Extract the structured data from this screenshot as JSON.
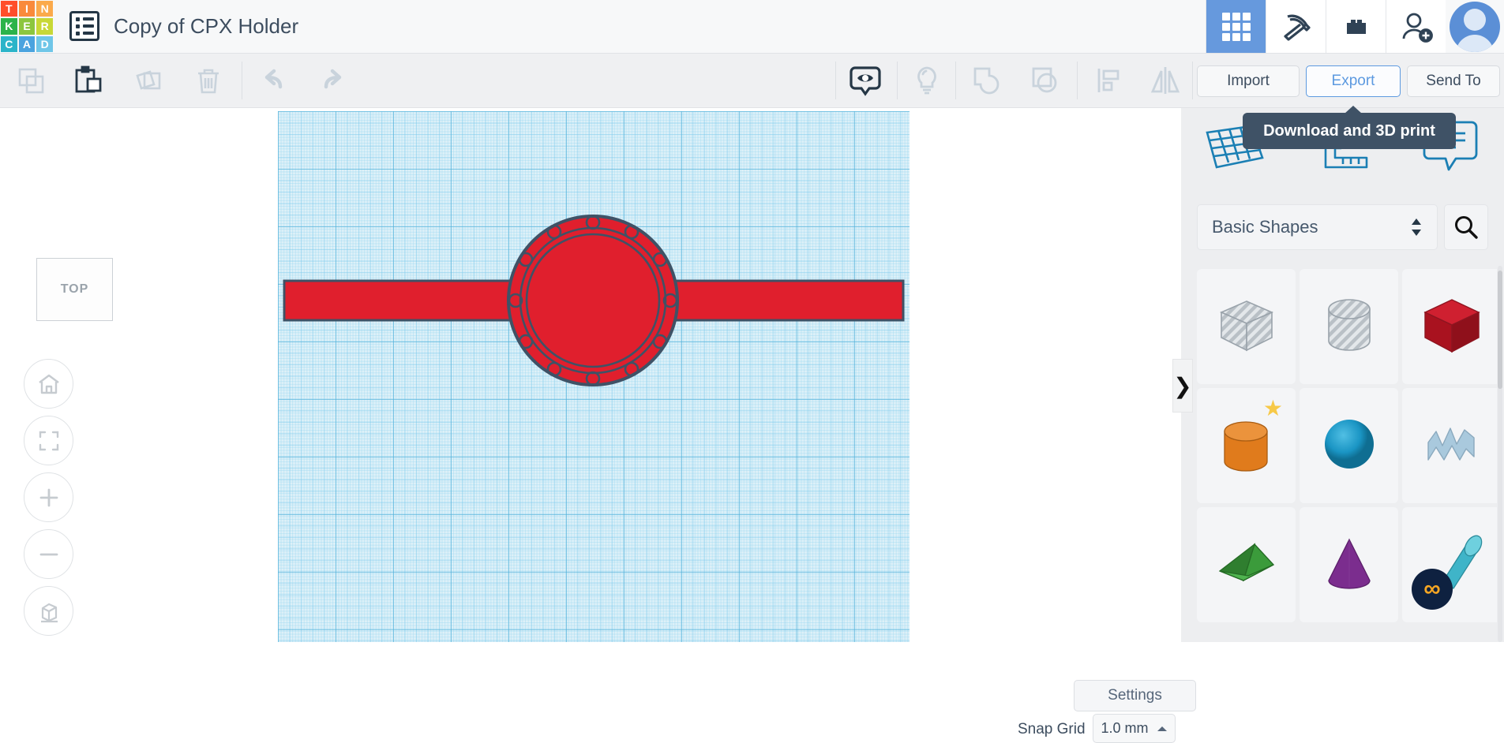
{
  "app": {
    "name": "Tinkercad",
    "logo_letters": [
      "T",
      "I",
      "N",
      "K",
      "E",
      "R",
      "C",
      "A",
      "D"
    ],
    "logo_colors": [
      "#ff4e2a",
      "#f98a3c",
      "#fbaa4b",
      "#2cb34a",
      "#8cc63e",
      "#c8d836",
      "#2bb4c9",
      "#4aa3df",
      "#6fc6e8"
    ],
    "document_title": "Copy of CPX Holder"
  },
  "topbar": {
    "icons": [
      {
        "name": "apps-grid-icon",
        "label": "Designs",
        "active": true
      },
      {
        "name": "pickaxe-icon",
        "label": "Minecraft",
        "active": false
      },
      {
        "name": "lego-brick-icon",
        "label": "Blocks",
        "active": false
      },
      {
        "name": "add-person-icon",
        "label": "Invite",
        "active": false
      }
    ],
    "avatar_label": "Account",
    "active_color": "#6699dd"
  },
  "toolbar": {
    "edit_tools": [
      {
        "name": "copy-icon",
        "label": "Copy",
        "enabled": false
      },
      {
        "name": "paste-icon",
        "label": "Paste",
        "enabled": true
      },
      {
        "name": "duplicate-icon",
        "label": "Duplicate",
        "enabled": false
      },
      {
        "name": "delete-icon",
        "label": "Delete",
        "enabled": false
      }
    ],
    "history_tools": [
      {
        "name": "undo-icon",
        "label": "Undo",
        "enabled": false
      },
      {
        "name": "redo-icon",
        "label": "Redo",
        "enabled": false
      }
    ],
    "view_tools": [
      {
        "name": "show-hide-eye-icon",
        "label": "Show/Hide",
        "enabled": true
      },
      {
        "name": "lightbulb-icon",
        "label": "Hint",
        "enabled": false
      }
    ],
    "shape_tools": [
      {
        "name": "group-icon",
        "label": "Group",
        "enabled": false
      },
      {
        "name": "ungroup-icon",
        "label": "Ungroup",
        "enabled": false
      }
    ],
    "arrange_tools": [
      {
        "name": "align-icon",
        "label": "Align",
        "enabled": false
      },
      {
        "name": "mirror-icon",
        "label": "Mirror",
        "enabled": false
      }
    ],
    "import_label": "Import",
    "export_label": "Export",
    "sendto_label": "Send To",
    "export_highlight_color": "#5d9ae0"
  },
  "tooltip": {
    "text": "Download and 3D print"
  },
  "canvas": {
    "viewcube_label": "TOP",
    "nav_buttons": [
      {
        "name": "home-view-icon",
        "label": "Home view"
      },
      {
        "name": "fit-to-view-icon",
        "label": "Fit all in view"
      },
      {
        "name": "zoom-in-icon",
        "label": "Zoom in"
      },
      {
        "name": "zoom-out-icon",
        "label": "Zoom out"
      },
      {
        "name": "perspective-toggle-icon",
        "label": "Switch to orthographic view"
      }
    ],
    "settings_label": "Settings",
    "snap_grid_label": "Snap Grid",
    "snap_grid_value": "1.0 mm",
    "grid_color": "#ddf0f8",
    "model_color": "#e01f2d",
    "model_outline_color": "#3f5266"
  },
  "right_panel": {
    "tools": [
      {
        "name": "workplane-icon",
        "label": "Workplane"
      },
      {
        "name": "ruler-icon",
        "label": "Ruler"
      },
      {
        "name": "notes-icon",
        "label": "Notes"
      }
    ],
    "category_value": "Basic Shapes",
    "search_label": "Search shapes",
    "collapse_label": "❯",
    "shapes": [
      {
        "name": "shape-box-hole",
        "label": "Box (hole)",
        "kind": "hole-box"
      },
      {
        "name": "shape-cylinder-hole",
        "label": "Cylinder (hole)",
        "kind": "hole-cylinder"
      },
      {
        "name": "shape-box",
        "label": "Box",
        "kind": "box",
        "color": "#cf2030"
      },
      {
        "name": "shape-cylinder",
        "label": "Cylinder",
        "kind": "cylinder",
        "color": "#e07b1c",
        "badge": "star"
      },
      {
        "name": "shape-sphere",
        "label": "Sphere",
        "kind": "sphere",
        "color": "#1a95c4"
      },
      {
        "name": "shape-scribble",
        "label": "Scribble",
        "kind": "scribble",
        "color": "#a9c9dd"
      },
      {
        "name": "shape-pyramid",
        "label": "Pyramid",
        "kind": "pyramid",
        "color": "#3b9b3b"
      },
      {
        "name": "shape-cone",
        "label": "Cone",
        "kind": "cone",
        "color": "#7b2d8e"
      },
      {
        "name": "shape-tube",
        "label": "Tube",
        "kind": "tube",
        "color": "#3fb4c8",
        "badge": "logo"
      }
    ]
  }
}
